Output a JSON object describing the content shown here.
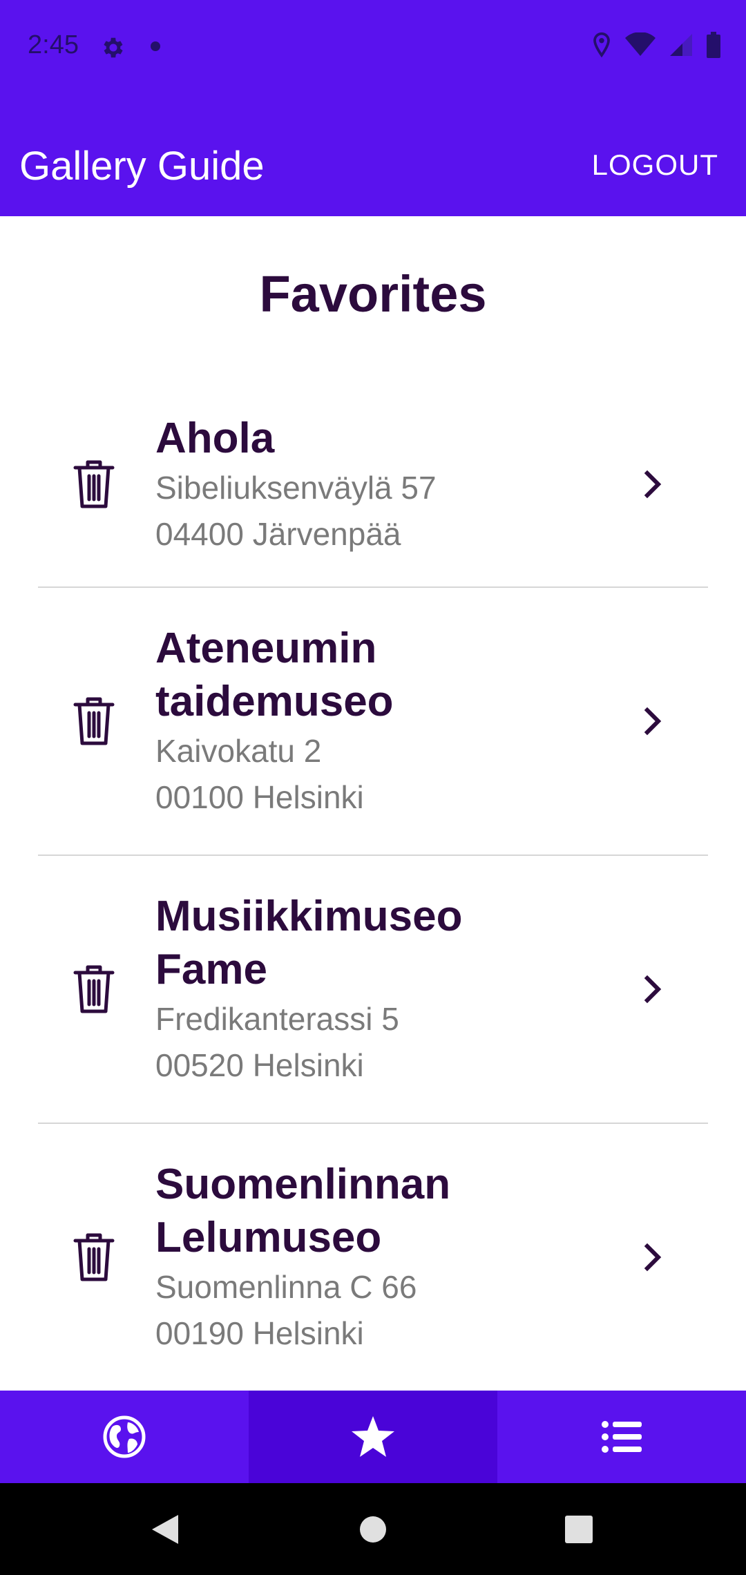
{
  "status_bar": {
    "time": "2:45"
  },
  "app_bar": {
    "title": "Gallery Guide",
    "logout_label": "LOGOUT"
  },
  "page": {
    "title": "Favorites"
  },
  "favorites": [
    {
      "name_lines": [
        "Ahola"
      ],
      "street": "Sibeliuksenväylä 57",
      "city": "04400 Järvenpää"
    },
    {
      "name_lines": [
        "Ateneumin",
        "taidemuseo"
      ],
      "street": "Kaivokatu 2",
      "city": "00100 Helsinki"
    },
    {
      "name_lines": [
        "Musiikkimuseo",
        "Fame"
      ],
      "street": "Fredikanterassi 5",
      "city": "00520 Helsinki"
    },
    {
      "name_lines": [
        "Suomenlinnan",
        "Lelumuseo"
      ],
      "street": "Suomenlinna C 66",
      "city": "00190 Helsinki"
    }
  ],
  "bottom_nav": {
    "items": [
      {
        "icon": "globe-icon",
        "active": false
      },
      {
        "icon": "star-icon",
        "active": true
      },
      {
        "icon": "list-icon",
        "active": false
      }
    ]
  },
  "colors": {
    "primary": "#5a12ee",
    "primary_dark": "#4a04d8",
    "title_text": "#2c0b3d",
    "secondary_text": "#7a7a7a"
  }
}
